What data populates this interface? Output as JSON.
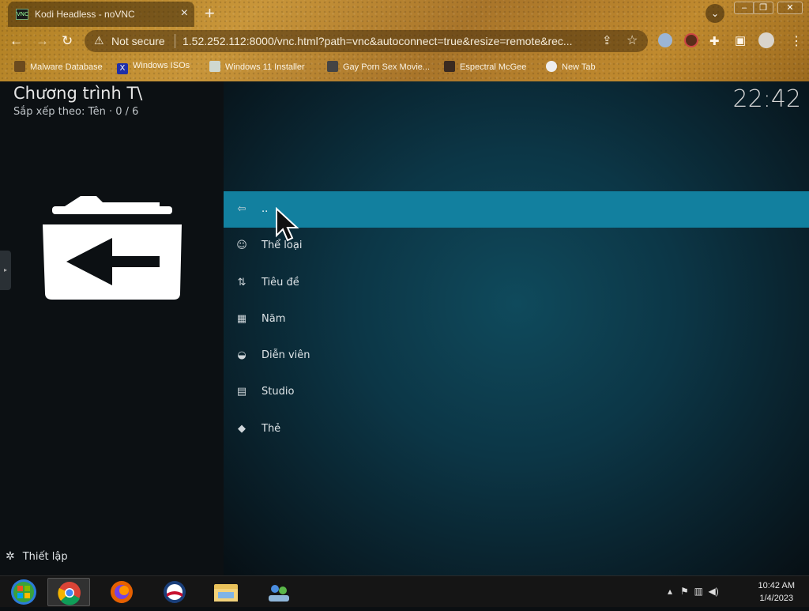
{
  "browser": {
    "tab_title": "Kodi Headless - noVNC",
    "tab_favicon_text": "VNC",
    "not_secure": "Not secure",
    "url": "1.52.252.112:8000/vnc.html?path=vnc&autoconnect=true&resize=remote&rec...",
    "bookmarks": [
      {
        "label": "Malware Database"
      },
      {
        "label": "Windows ISOs"
      },
      {
        "label": "Windows 11 Installer"
      },
      {
        "label": "Gay Porn Sex Movie..."
      },
      {
        "label": "Espectral McGee"
      },
      {
        "label": "New Tab"
      }
    ]
  },
  "kodi": {
    "title": "Chương trình T\\",
    "sort_text": "Sắp xếp theo: Tên  ·  0 / 6",
    "clock": "22:42",
    "menu": [
      {
        "label": "..",
        "icon": "back-folder-icon",
        "selected": true
      },
      {
        "label": "Thể loại",
        "icon": "masks-icon"
      },
      {
        "label": "Tiêu đề",
        "icon": "sort-az-icon"
      },
      {
        "label": "Năm",
        "icon": "calendar-icon"
      },
      {
        "label": "Diễn viên",
        "icon": "mask-icon"
      },
      {
        "label": "Studio",
        "icon": "clapperboard-icon"
      },
      {
        "label": "Thẻ",
        "icon": "tag-icon"
      }
    ],
    "settings_label": "Thiết lập"
  },
  "taskbar": {
    "time": "10:42 AM",
    "date": "1/4/2023"
  }
}
